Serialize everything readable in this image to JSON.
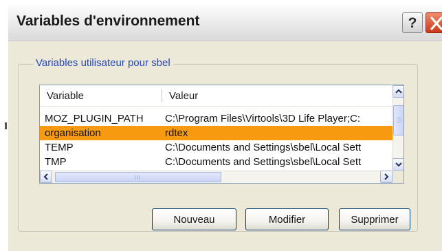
{
  "window": {
    "title": "Variables d'environnement",
    "help_label": "?",
    "help_icon": "help-icon",
    "close_icon": "close-icon"
  },
  "user_group": {
    "legend": "Variables utilisateur pour sbel",
    "columns": [
      "Variable",
      "Valeur"
    ],
    "rows": [
      {
        "variable": "MOZ_PLUGIN_PATH",
        "value": "C:\\Program Files\\Virtools\\3D Life Player;C:",
        "selected": false
      },
      {
        "variable": "organisation",
        "value": "rdtex",
        "selected": true
      },
      {
        "variable": "TEMP",
        "value": "C:\\Documents and Settings\\sbel\\Local Sett",
        "selected": false
      },
      {
        "variable": "TMP",
        "value": "C:\\Documents and Settings\\sbel\\Local Sett",
        "selected": false
      }
    ],
    "selection_color": "#f89a10"
  },
  "buttons": {
    "new_label": "Nouveau",
    "edit_label": "Modifier",
    "delete_label": "Supprimer"
  }
}
